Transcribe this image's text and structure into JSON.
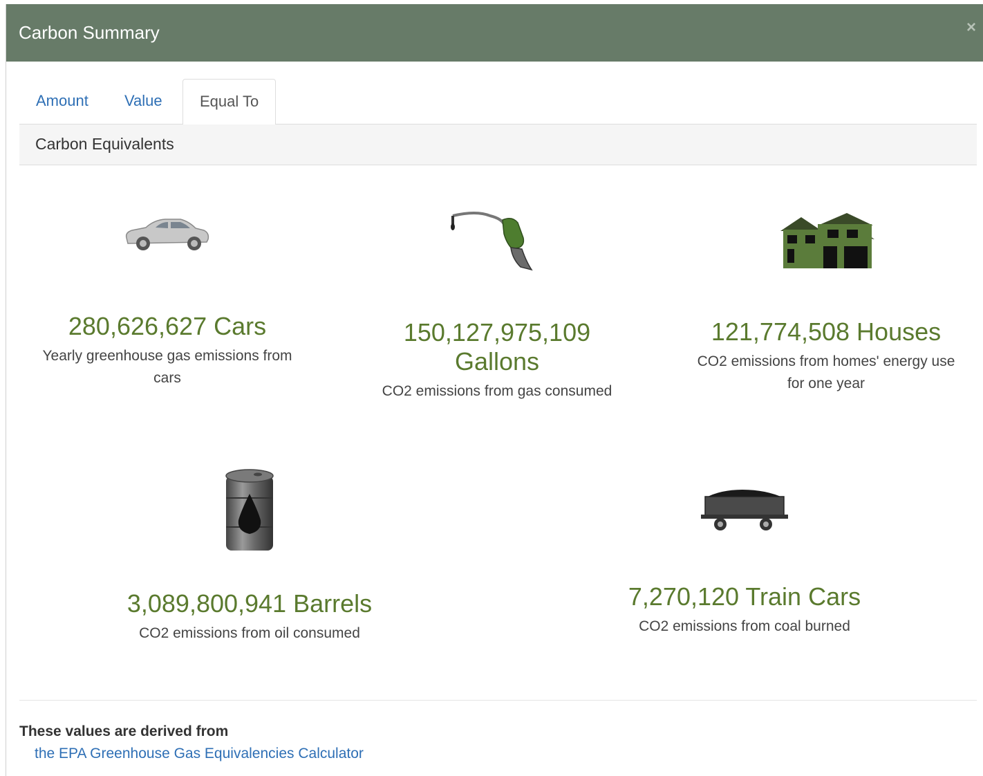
{
  "modal": {
    "title": "Carbon Summary",
    "close_label": "×"
  },
  "tabs": [
    {
      "label": "Amount",
      "active": false
    },
    {
      "label": "Value",
      "active": false
    },
    {
      "label": "Equal To",
      "active": true
    }
  ],
  "panel": {
    "heading": "Carbon Equivalents"
  },
  "equivalents": [
    {
      "icon": "car-icon",
      "value": "280,626,627 Cars",
      "description": "Yearly greenhouse gas emissions from cars"
    },
    {
      "icon": "fuel-nozzle-icon",
      "value": "150,127,975,109 Gallons",
      "description": "CO2 emissions from gas consumed"
    },
    {
      "icon": "houses-icon",
      "value": "121,774,508 Houses",
      "description": "CO2 emissions from homes' energy use for one year"
    },
    {
      "icon": "oil-barrel-icon",
      "value": "3,089,800,941 Barrels",
      "description": "CO2 emissions from oil consumed"
    },
    {
      "icon": "coal-train-car-icon",
      "value": "7,270,120 Train Cars",
      "description": "CO2 emissions from coal burned"
    }
  ],
  "footer": {
    "note": "These values are derived from",
    "link_text": "the EPA Greenhouse Gas Equivalencies Calculator"
  },
  "colors": {
    "header": "#677b68",
    "value_green": "#5a7a2e",
    "link_blue": "#2e6fb5",
    "house_green": "#5b7c3b"
  }
}
